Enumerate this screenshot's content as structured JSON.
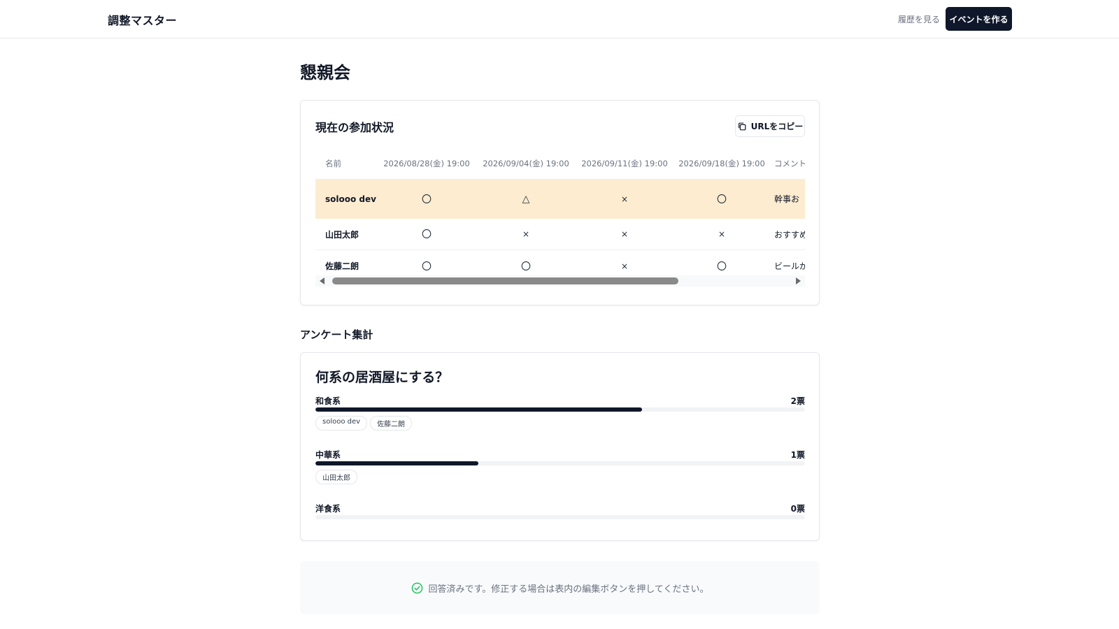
{
  "app": {
    "title": "調整マスター"
  },
  "header": {
    "history_label": "履歴を見る",
    "create_label": "イベントを作る"
  },
  "event": {
    "title": "懇親会"
  },
  "status": {
    "heading": "現在の参加状況",
    "copy_label": "URLをコピー",
    "columns": [
      "名前",
      "2026/08/28(金) 19:00",
      "2026/09/04(金) 19:00",
      "2026/09/11(金) 19:00",
      "2026/09/18(金) 19:00",
      "コメント"
    ],
    "rows": [
      {
        "name": "solooo dev",
        "marks": [
          "〇",
          "△",
          "×",
          "〇"
        ],
        "comment": "幹事お",
        "highlighted": true
      },
      {
        "name": "山田太郎",
        "marks": [
          "〇",
          "×",
          "×",
          "×"
        ],
        "comment": "おすすめ"
      },
      {
        "name": "佐藤二朗",
        "marks": [
          "〇",
          "〇",
          "×",
          "〇"
        ],
        "comment": "ビールが"
      }
    ],
    "highlight_color": "#fdecd0"
  },
  "survey": {
    "heading": "アンケート集計",
    "question": "何系の居酒屋にする？",
    "options": [
      {
        "label": "和食系",
        "votes": "2票",
        "fill_fraction": 0.667,
        "voters": [
          "solooo dev",
          "佐藤二朗"
        ]
      },
      {
        "label": "中華系",
        "votes": "1票",
        "fill_fraction": 0.333,
        "voters": [
          "山田太郎"
        ]
      },
      {
        "label": "洋食系",
        "votes": "0票",
        "fill_fraction": 0,
        "voters": []
      }
    ]
  },
  "notice": {
    "text": "回答済みです。修正する場合は表内の編集ボタンを押してください。"
  },
  "colors": {
    "accent": "#0f172a",
    "success": "#22c55e"
  }
}
